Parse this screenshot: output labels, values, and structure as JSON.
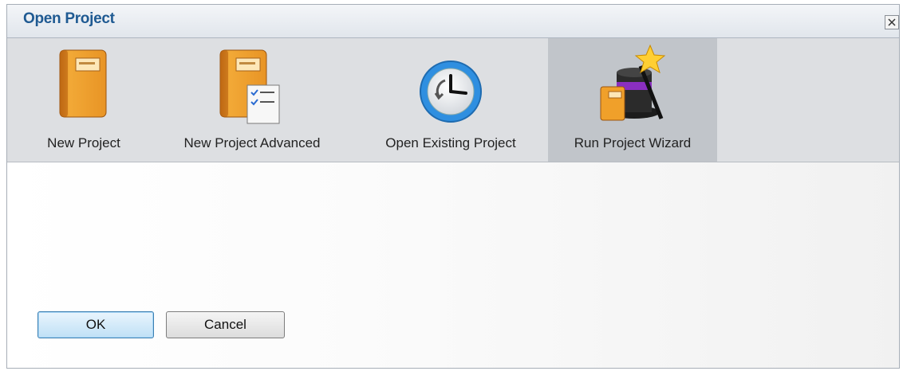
{
  "window": {
    "title": "Open Project"
  },
  "tools": [
    {
      "label": "New Project",
      "icon": "notebook-icon",
      "selected": false
    },
    {
      "label": "New Project Advanced",
      "icon": "notebook-checklist-icon",
      "selected": false
    },
    {
      "label": "Open Existing Project",
      "icon": "clock-icon",
      "selected": false
    },
    {
      "label": "Run Project Wizard",
      "icon": "magic-hat-icon",
      "selected": true
    }
  ],
  "buttons": {
    "ok": "OK",
    "cancel": "Cancel"
  },
  "colors": {
    "title": "#1f5a92",
    "toolbar_bg": "#dddfe2",
    "selected_tool_bg": "#c1c5ca",
    "notebook_orange": "#f0a02a",
    "clock_blue": "#2f8fe0"
  }
}
